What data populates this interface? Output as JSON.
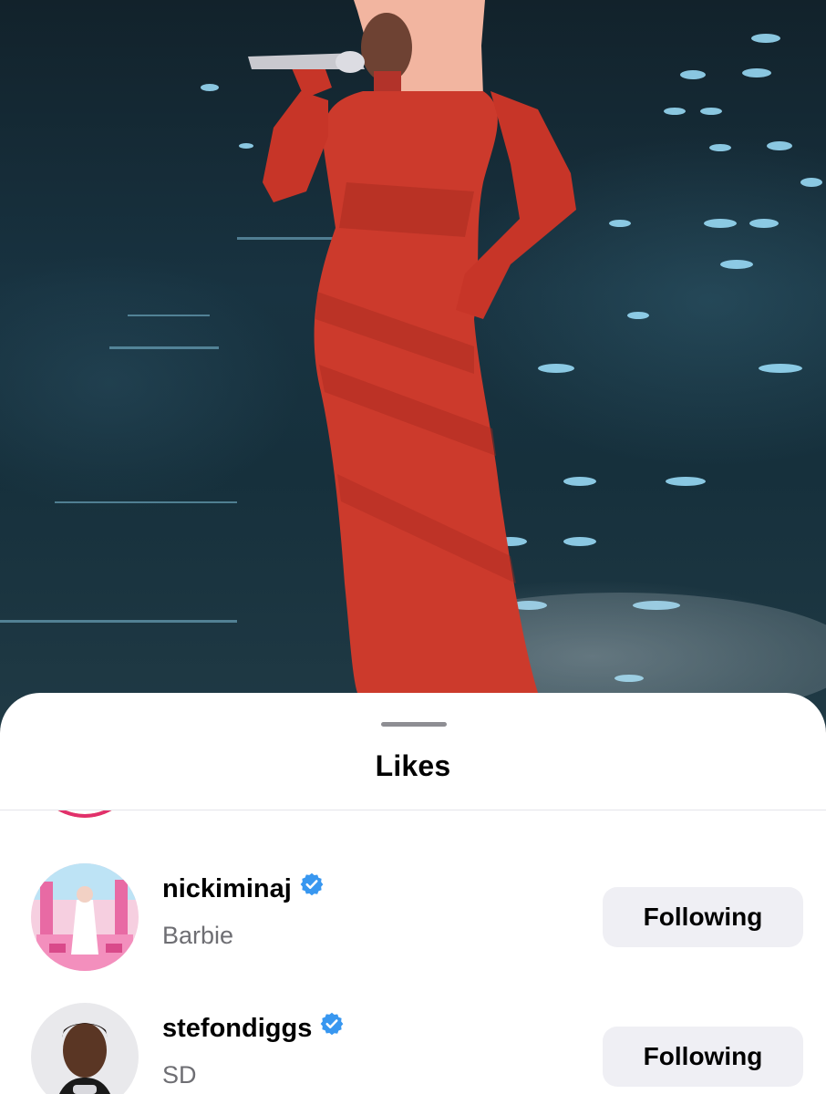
{
  "sheet": {
    "title": "Likes"
  },
  "likes": [
    {
      "username": "nickiminaj",
      "full_name": "Barbie",
      "verified": true,
      "button_label": "Following"
    },
    {
      "username": "stefondiggs",
      "full_name": "SD",
      "verified": true,
      "button_label": "Following"
    }
  ],
  "colors": {
    "verified_badge": "#3897f0",
    "button_bg": "#efeff4",
    "secondary_text": "#6e6e73",
    "story_ring": "#e1306c"
  },
  "icons": {
    "verified": "verified-check-badge-icon"
  }
}
